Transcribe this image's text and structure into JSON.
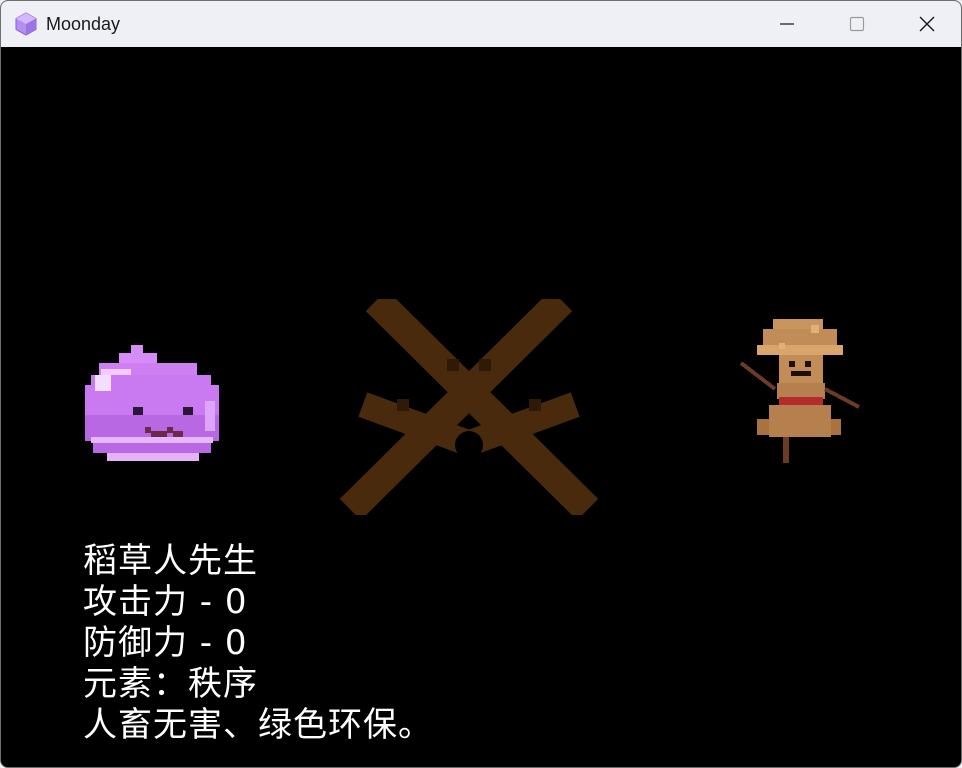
{
  "window": {
    "title": "Moonday",
    "icon": "purple-cube-icon",
    "controls": [
      "minimize-icon",
      "maximize-icon",
      "close-icon"
    ]
  },
  "scene": {
    "player_sprite": "purple-slime",
    "center_sprite": "crossed-wooden-sticks",
    "enemy_sprite": "scarecrow"
  },
  "info": {
    "name": "稻草人先生",
    "attack": "攻击力 - 0",
    "defense": "防御力 - 0",
    "element": "元素：秩序",
    "description": "人畜无害、绿色环保。"
  },
  "colors": {
    "background": "#000000",
    "text": "#ffffff",
    "slime": "#c77df0",
    "wood": "#4a2a0c",
    "scarecrow": "#c9955e"
  }
}
